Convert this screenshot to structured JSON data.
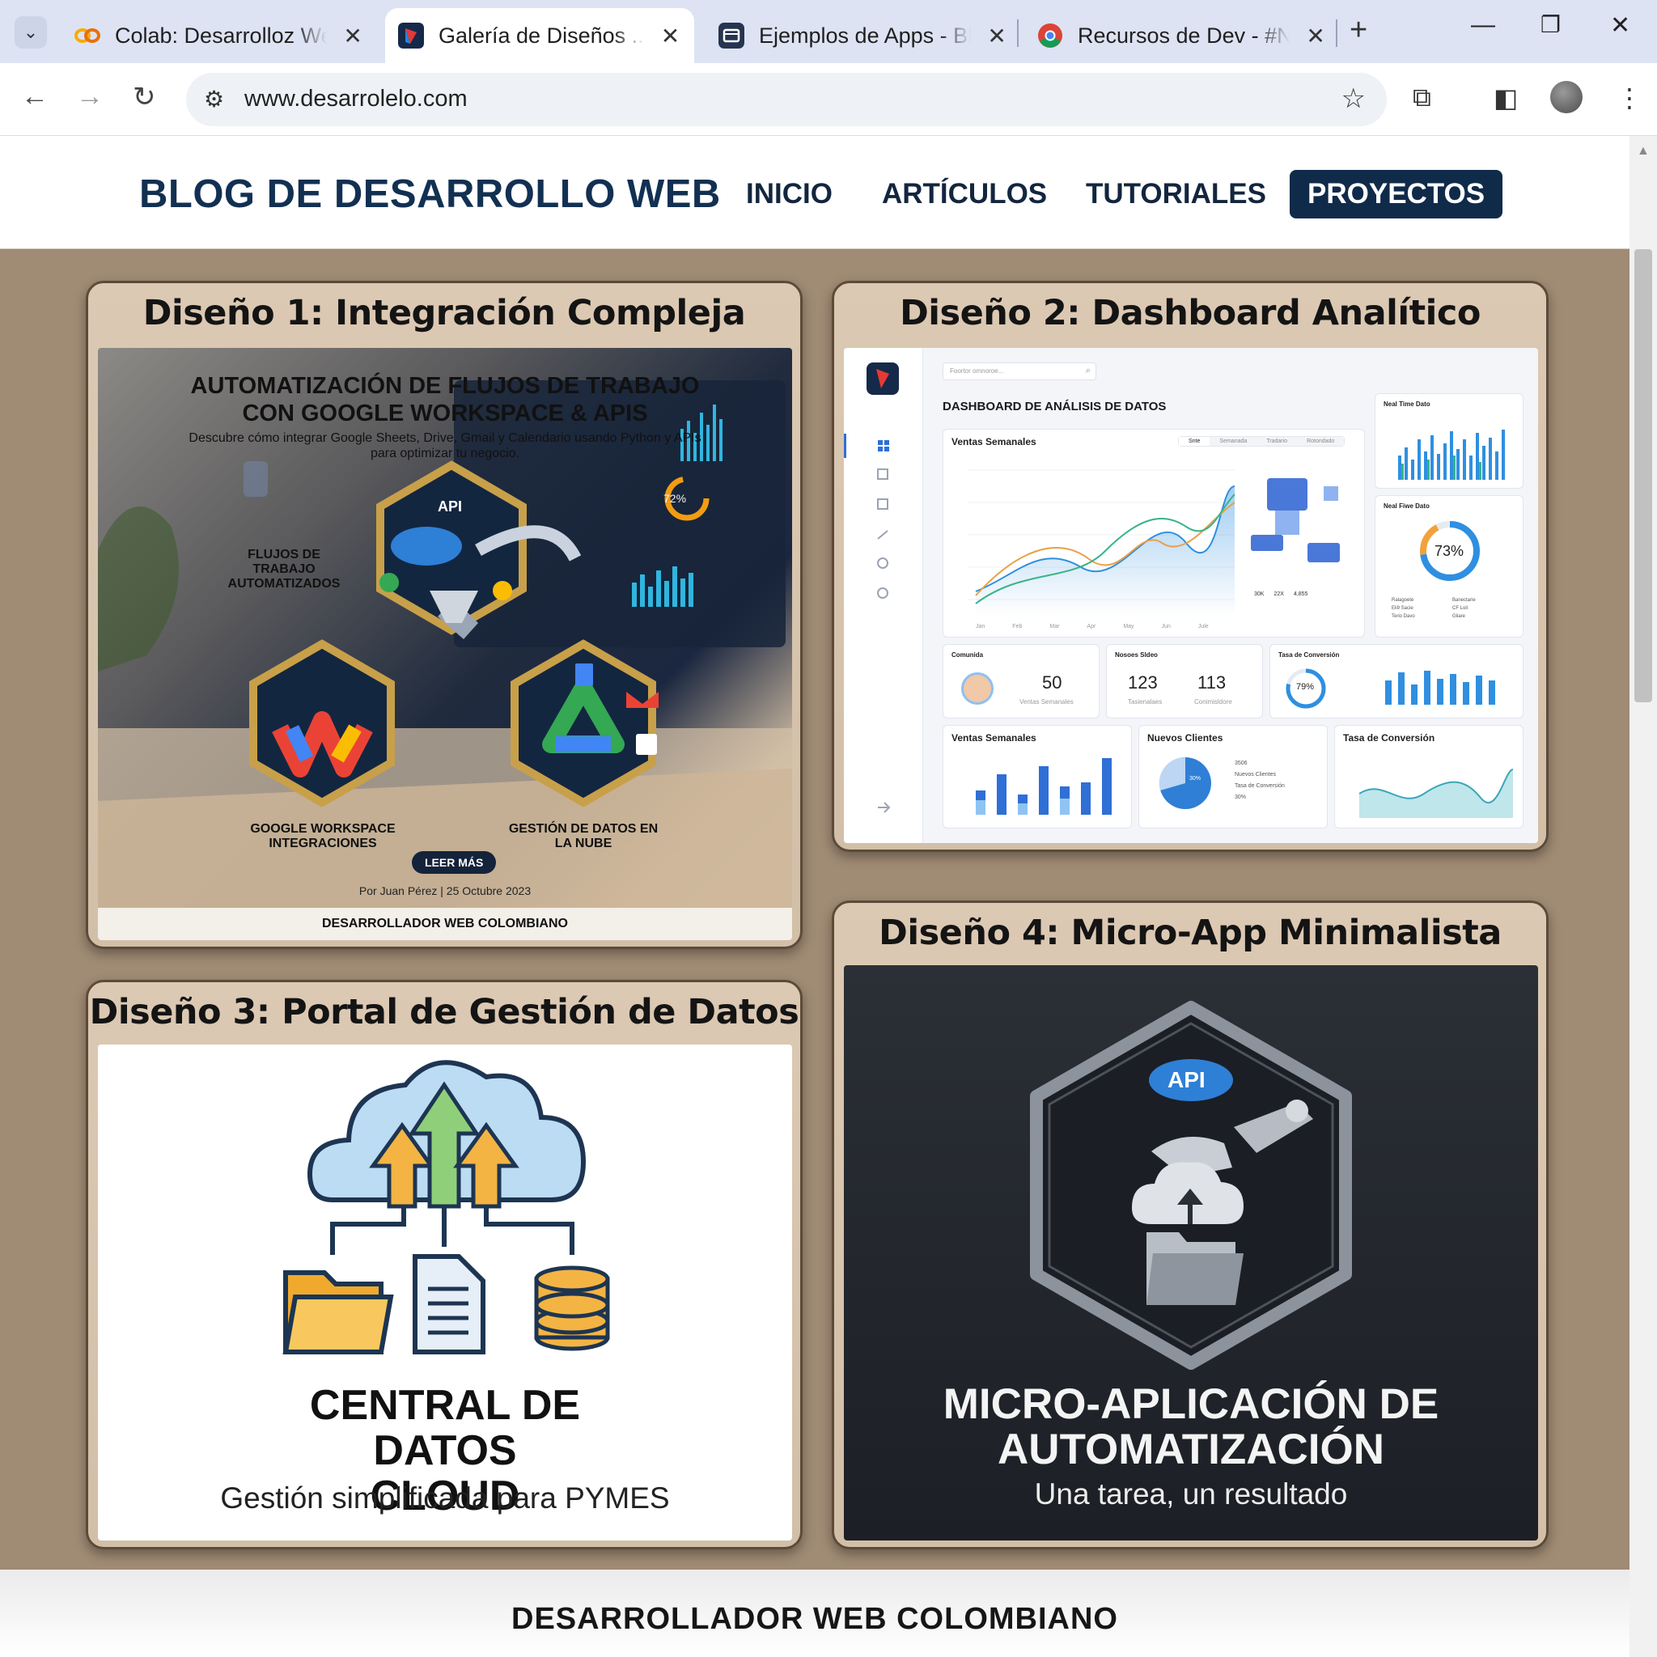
{
  "browser": {
    "tabs": [
      {
        "title": "Colab: Desarrolloz Web",
        "favicon": "colab-icon",
        "active": false
      },
      {
        "title": "Galería de Diseños ... W",
        "favicon": "gallery-icon",
        "active": true
      },
      {
        "title": "Ejemplos de Apps - Blbl",
        "favicon": "apps-icon",
        "active": false
      },
      {
        "title": "Recursos de Dev - #Ne",
        "favicon": "chrome-icon",
        "active": false
      }
    ],
    "url": "www.desarrolelo.com"
  },
  "site": {
    "brand": "BLOG DE DESARROLLO WEB",
    "nav": [
      "INICIO",
      "ARTÍCULOS",
      "TUTORIALES",
      "PROYECTOS"
    ],
    "footer": "DESARROLLADOR WEB COLOMBIANO"
  },
  "designs": [
    {
      "title": "Diseño 1: Integración Compleja",
      "headline": "AUTOMATIZACIÓN DE FLUJOS DE TRABAJO CON GOOGLE WORKSPACE & APIS",
      "subtitle": "Descubre cómo integrar Google Sheets, Drive, Gmail y Calendario usando Python y APIs para optimizar tu negocio.",
      "badge_flujos": "FLUJOS DE TRABAJO AUTOMATIZADOS",
      "badge_api": "API",
      "badge_workspace": "GOOGLE WORKSPACE INTEGRACIONES",
      "badge_datos": "GESTIÓN DE DATOS EN LA NUBE",
      "button": "LEER MÁS",
      "author": "Por Juan Pérez | 25 Octubre 2023",
      "footer": "DESARROLLADOR WEB COLOMBIANO",
      "screen_donut": "72%"
    },
    {
      "title": "Diseño 2: Dashboard Analítico",
      "search_placeholder": "Foortor omnoroe...",
      "heading": "DASHBOARD DE ANÁLISIS DE DATOS",
      "weekly_sales": "Ventas Semanales",
      "filters": [
        "Snte",
        "Semanada",
        "Tradario",
        "Rotondado"
      ],
      "realtime": "Neal Time Dato",
      "ring_title": "Neal Fiwe Dato",
      "ring_value": "73%",
      "ring_legend": [
        "Ralagoete",
        "Banectarie",
        "Eli9 Sacie",
        "CF Loil",
        "Terio Davo",
        "Gliare"
      ],
      "community": {
        "title": "Comunida",
        "value": "50",
        "caption": "Ventas Semanales"
      },
      "sessions": {
        "title": "Nosoes Sldeo",
        "v1": "123",
        "c1": "Tasienalaes",
        "v2": "113",
        "c2": "Conimisldore"
      },
      "conversion": {
        "title": "Tasa de Conversión",
        "value": "79%"
      },
      "bottom": [
        "Ventas Semanales",
        "Nuevos Clientes",
        "Tasa de Conversión"
      ],
      "pie_label": "30%",
      "pie_legend": [
        "3506",
        "Nuevos Clientes",
        "Tasa de Conversión",
        "30%"
      ],
      "stat_chips": [
        "30K",
        "22X",
        "4,855"
      ],
      "months": [
        "Jan",
        "Feb",
        "Mar",
        "Apr",
        "May",
        "Jun",
        "Jule"
      ]
    },
    {
      "title": "Diseño 3: Portal de Gestión de Datos",
      "headline": "CENTRAL DE DATOS CLOUD",
      "subtitle": "Gestión simplificada para PYMES"
    },
    {
      "title": "Diseño 4: Micro-App Minimalista",
      "badge": "API",
      "headline": "MICRO-APLICACIÓN DE AUTOMATIZACIÓN",
      "subtitle": "Una tarea, un resultado"
    }
  ],
  "colors": {
    "brand": "#123052",
    "cta": "#102a4a",
    "page_bg": "#a08b74",
    "card_bg": "#d8c5ae"
  }
}
